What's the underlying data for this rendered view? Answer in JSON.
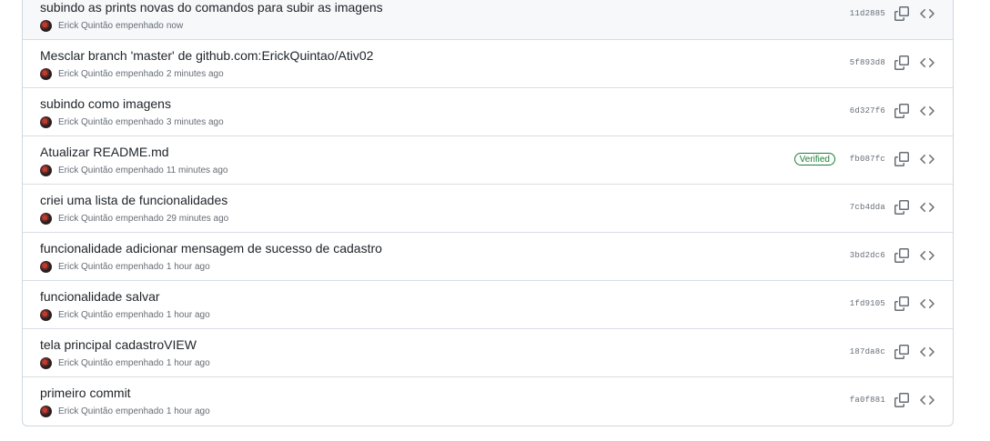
{
  "commits": [
    {
      "title": "subindo as prints novas do comandos para subir as imagens",
      "author": "Erick Quintão",
      "action": "empenhado",
      "time": "now",
      "sha": "11d2885",
      "verified": false
    },
    {
      "title": "Mesclar branch 'master' de github.com:ErickQuintao/Ativ02",
      "author": "Erick Quintão",
      "action": "empenhado",
      "time": "2 minutes ago",
      "sha": "5f893d8",
      "verified": false
    },
    {
      "title": "subindo como imagens",
      "author": "Erick Quintão",
      "action": "empenhado",
      "time": "3 minutes ago",
      "sha": "6d327f6",
      "verified": false
    },
    {
      "title": "Atualizar README.md",
      "author": "Erick Quintão",
      "action": "empenhado",
      "time": "11 minutes ago",
      "sha": "fb087fc",
      "verified": true,
      "verified_label": "Verified"
    },
    {
      "title": "criei uma lista de funcionalidades",
      "author": "Erick Quintão",
      "action": "empenhado",
      "time": "29 minutes ago",
      "sha": "7cb4dda",
      "verified": false
    },
    {
      "title": "funcionalidade adicionar mensagem de sucesso de cadastro",
      "author": "Erick Quintão",
      "action": "empenhado",
      "time": "1 hour ago",
      "sha": "3bd2dc6",
      "verified": false
    },
    {
      "title": "funcionalidade salvar",
      "author": "Erick Quintão",
      "action": "empenhado",
      "time": "1 hour ago",
      "sha": "1fd9105",
      "verified": false
    },
    {
      "title": "tela principal cadastroVIEW",
      "author": "Erick Quintão",
      "action": "empenhado",
      "time": "1 hour ago",
      "sha": "187da8c",
      "verified": false
    },
    {
      "title": "primeiro commit",
      "author": "Erick Quintão",
      "action": "empenhado",
      "time": "1 hour ago",
      "sha": "fa0f881",
      "verified": false
    }
  ],
  "icons": {
    "copy": "copy-icon",
    "browse": "code-icon"
  },
  "colors": {
    "verified": "#1a7f37",
    "muted": "#656d76",
    "border": "#d0d7de"
  }
}
